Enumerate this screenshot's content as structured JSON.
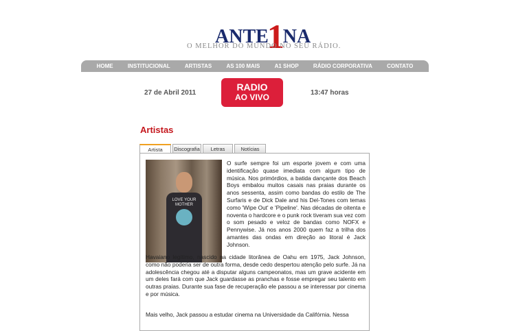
{
  "logo": {
    "brand_left": "ANTE",
    "brand_number": "1",
    "brand_right": "NA",
    "tagline": "O MELHOR DO MUNDO NO SEU RÁDIO."
  },
  "nav": [
    "HOME",
    "INSTITUCIONAL",
    "ARTISTAS",
    "AS 100 MAIS",
    "A1 SHOP",
    "RÁDIO CORPORATIVA",
    "CONTATO"
  ],
  "date": "27 de Abril 2011",
  "time": "13:47 horas",
  "radio": {
    "line1": "RADIO",
    "line2": "AO VIVO"
  },
  "section_title": "Artistas",
  "tabs": [
    "Artista",
    "Discografia",
    "Letras",
    "Notícias"
  ],
  "photo_text": {
    "line1": "LOVE YOUR",
    "line2": "MOTHER"
  },
  "paragraphs": [
    "O surfe sempre foi um esporte jovem e com uma identificação quase imediata com algum tipo de música. Nos primórdios, a batida dançante dos Beach Boys embalou muitos casais nas praias durante os anos sessenta, assim como bandas do estilo de The Surfaris e de Dick Dale and his Del-Tones com temas como 'Wipe Out' e 'Pipeline'. Nas décadas de oitenta e noventa o hardcore e o punk rock tiveram sua vez com o som pesado e veloz de bandas como NOFX e Pennywise. Já nos anos 2000 quem faz a trilha dos amantes das ondas em direção ao litoral é Jack Johnson.",
    "Havaiano legítimo, nascido na cidade litorânea de Oahu em 1975, Jack Johnson, como não poderia ser de outra forma, desde cedo despertou atenção pelo surfe. Já na adolescência chegou até a disputar alguns campeonatos, mas um grave acidente em um deles fará com que Jack guardasse as pranchas e fosse empregar seu talento em outras praias. Durante sua fase de recuperação ele passou a se interessar por cinema e por música.",
    "Mais velho, Jack passou a estudar cinema na Universidade da Califórnia. Nessa"
  ]
}
